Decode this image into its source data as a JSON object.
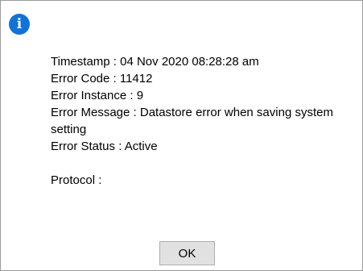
{
  "dialog": {
    "icon": "info-icon",
    "icon_glyph": "i",
    "accent_color": "#1572d3",
    "lines": {
      "timestamp": "Timestamp : 04 Nov 2020 08:28:28 am",
      "error_code": "Error Code : 11412",
      "error_instance": "Error Instance : 9",
      "error_message": "Error Message : Datastore error when saving system setting",
      "error_status": "Error Status : Active",
      "protocol": "Protocol :"
    },
    "ok_label": "OK"
  }
}
